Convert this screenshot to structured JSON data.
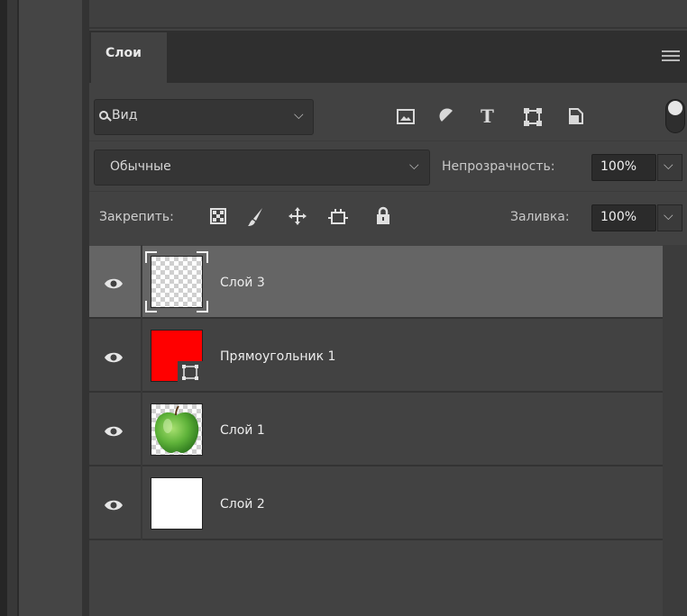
{
  "panel": {
    "tab_label": "Слои"
  },
  "filter": {
    "search_label": "Вид",
    "icons": [
      "image-filter-icon",
      "adjustment-filter-icon",
      "type-filter-icon",
      "shape-filter-icon",
      "smart-object-filter-icon"
    ],
    "type_icon_glyph": "T"
  },
  "blend": {
    "mode": "Обычные",
    "opacity_label": "Непрозрачность:",
    "opacity_value": "100%"
  },
  "lock": {
    "label": "Закрепить:",
    "icons": [
      "lock-transparent-pixels-icon",
      "lock-image-pixels-icon",
      "lock-position-icon",
      "lock-artboard-icon",
      "lock-all-icon"
    ],
    "fill_label": "Заливка:",
    "fill_value": "100%"
  },
  "layers": [
    {
      "name": "Слой 3",
      "thumbnail": "transparent",
      "selected": true,
      "visible": true
    },
    {
      "name": "Прямоугольник 1",
      "thumbnail": "red-shape",
      "selected": false,
      "visible": true
    },
    {
      "name": "Слой 1",
      "thumbnail": "green-apple",
      "selected": false,
      "visible": true
    },
    {
      "name": "Слой 2",
      "thumbnail": "white",
      "selected": false,
      "visible": true
    }
  ],
  "colors": {
    "panel_bg": "#424242",
    "selected_row": "#656565",
    "shape_red": "#ff0000",
    "apple_green": "#5fb33a"
  }
}
